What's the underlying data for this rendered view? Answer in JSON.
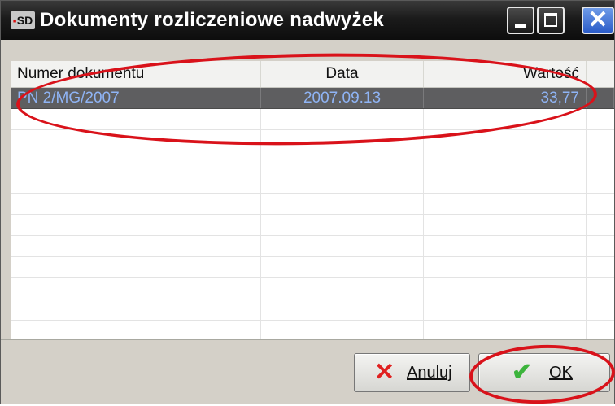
{
  "window": {
    "icon_text": "SD",
    "title": "Dokumenty rozliczeniowe nadwyżek",
    "minimize_label": "minimize",
    "maximize_label": "maximize",
    "close_label": "close"
  },
  "grid": {
    "columns": [
      "Numer dokumentu",
      "Data",
      "Wartość"
    ],
    "rows": [
      {
        "numer": "PN 2/MG/2007",
        "data": "2007.09.13",
        "wartosc": "33,77",
        "selected": true
      }
    ],
    "empty_rows": 10
  },
  "buttons": {
    "cancel_label": "Anuluj",
    "ok_label": "OK"
  },
  "icons": {
    "app": "app-logo-icon",
    "cancel": "x-icon",
    "ok": "checkmark-icon"
  },
  "colors": {
    "titlebar": "#1b1b1b",
    "selected_row_bg": "#5e5e60",
    "selected_row_text": "#8fb4f5",
    "annotation": "#d9121a",
    "close_button": "#2b5cc8"
  },
  "annotations": [
    "row-highlight-ellipse",
    "ok-button-highlight-ellipse"
  ]
}
